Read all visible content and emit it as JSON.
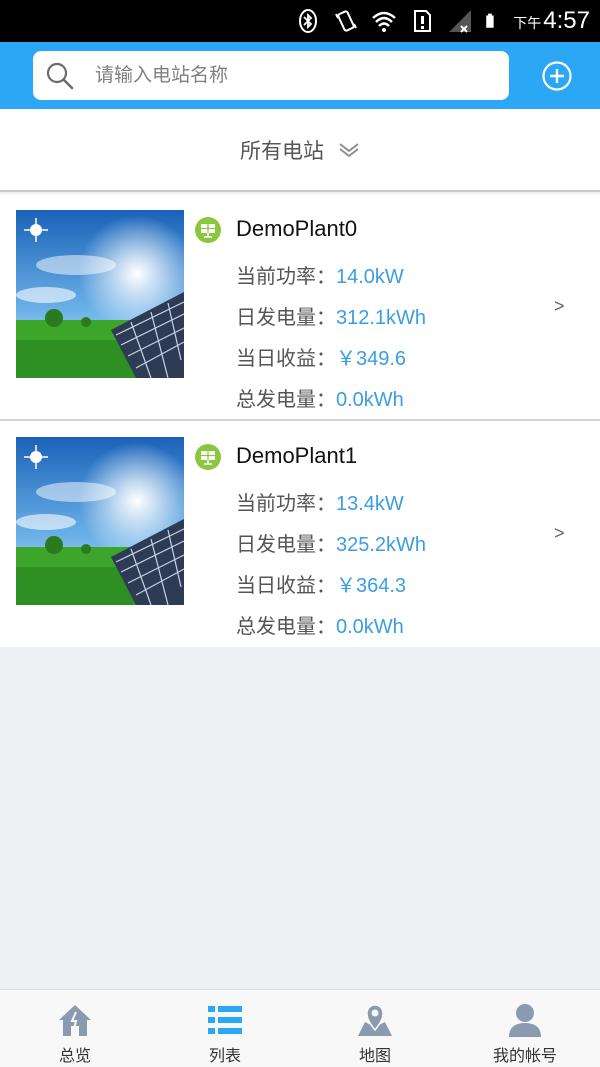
{
  "status_bar": {
    "ampm": "下午",
    "time": "4:57",
    "icons": [
      "bluetooth-icon",
      "vibrate-icon",
      "wifi-icon",
      "sim-icon",
      "signal-icon",
      "battery-icon"
    ]
  },
  "header": {
    "search_placeholder": "请输入电站名称",
    "search_value": "",
    "add_icon": "plus-circle-icon"
  },
  "filter": {
    "label": "所有电站",
    "icon": "chevron-down-icon"
  },
  "plants": [
    {
      "name": "DemoPlant0",
      "power_label": "当前功率：",
      "power_value": "14.0kW",
      "daily_energy_label": "日发电量：",
      "daily_energy_value": "312.1kWh",
      "daily_income_label": "当日收益：",
      "daily_income_value": "￥349.6",
      "total_energy_label": "总发电量：",
      "total_energy_value": "0.0kWh",
      "arrow": ">"
    },
    {
      "name": "DemoPlant1",
      "power_label": "当前功率：",
      "power_value": "13.4kW",
      "daily_energy_label": "日发电量：",
      "daily_energy_value": "325.2kWh",
      "daily_income_label": "当日收益：",
      "daily_income_value": "￥364.3",
      "total_energy_label": "总发电量：",
      "total_energy_value": "0.0kWh",
      "arrow": ">"
    }
  ],
  "nav": {
    "items": [
      {
        "label": "总览",
        "icon": "home-icon",
        "active": false
      },
      {
        "label": "列表",
        "icon": "list-icon",
        "active": true
      },
      {
        "label": "地图",
        "icon": "map-icon",
        "active": false
      },
      {
        "label": "我的帐号",
        "icon": "user-icon",
        "active": false
      }
    ]
  },
  "colors": {
    "header_blue": "#2ba7f5",
    "value_blue": "#3a9ee4",
    "plant_icon_green": "#8cc63f",
    "nav_inactive": "#8a9bb0",
    "nav_active": "#2ba7f5"
  }
}
